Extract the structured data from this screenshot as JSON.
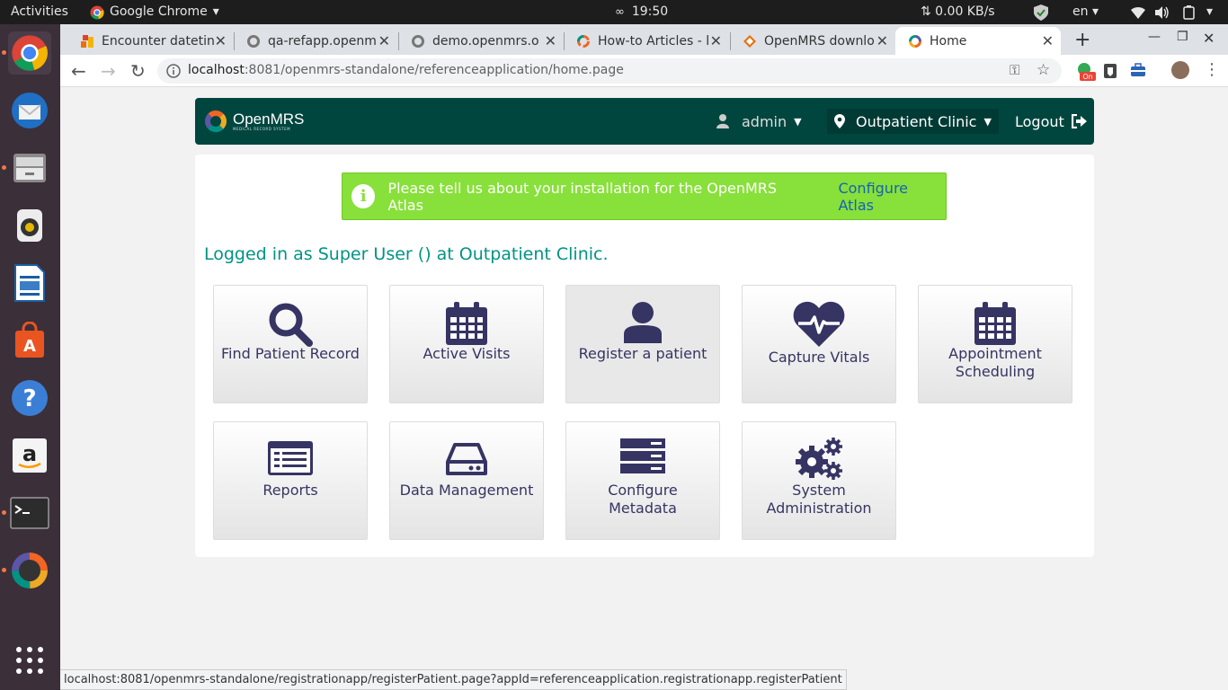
{
  "ubuntu_topbar": {
    "activities": "Activities",
    "app_name": "Google Chrome",
    "clock": "19:50",
    "network_speed": "⇅ 0.00 KB/s",
    "language": "en"
  },
  "dock": {
    "items": [
      "chrome",
      "thunderbird",
      "files",
      "rhythmbox",
      "writer",
      "software-center",
      "help",
      "amazon",
      "terminal",
      "openmrs"
    ]
  },
  "chrome": {
    "tabs": [
      {
        "title": "Encounter datetin",
        "active": false
      },
      {
        "title": "qa-refapp.openm",
        "active": false
      },
      {
        "title": "demo.openmrs.o",
        "active": false
      },
      {
        "title": "How-to Articles - l",
        "active": false
      },
      {
        "title": "OpenMRS downlo",
        "active": false
      },
      {
        "title": "Home",
        "active": true
      }
    ],
    "url_host": "localhost",
    "url_path": ":8081/openmrs-standalone/referenceapplication/home.page"
  },
  "header": {
    "brand": "OpenMRS",
    "tagline": "MEDICAL RECORD SYSTEM",
    "user": "admin",
    "location": "Outpatient Clinic",
    "logout": "Logout"
  },
  "atlas": {
    "message": "Please tell us about your installation for the OpenMRS Atlas",
    "link": "Configure Atlas"
  },
  "logged_in_text": "Logged in as Super User () at Outpatient Clinic.",
  "apps": [
    {
      "label": "Find Patient Record",
      "icon": "search-icon"
    },
    {
      "label": "Active Visits",
      "icon": "calendar-icon"
    },
    {
      "label": "Register a patient",
      "icon": "user-icon"
    },
    {
      "label": "Capture Vitals",
      "icon": "heartbeat-icon"
    },
    {
      "label": "Appointment Scheduling",
      "icon": "calendar-icon"
    },
    {
      "label": "Reports",
      "icon": "list-icon"
    },
    {
      "label": "Data Management",
      "icon": "hdd-icon"
    },
    {
      "label": "Configure Metadata",
      "icon": "server-icon"
    },
    {
      "label": "System Administration",
      "icon": "gears-icon"
    }
  ],
  "status_url": "localhost:8081/openmrs-standalone/registrationapp/registerPatient.page?appId=referenceapplication.registrationapp.registerPatient",
  "colors": {
    "header_bg": "#00463f",
    "atlas_bg": "#88e03a",
    "logged_in": "#009384",
    "icon": "#363463",
    "dock_bg": "#3b2f3a"
  }
}
